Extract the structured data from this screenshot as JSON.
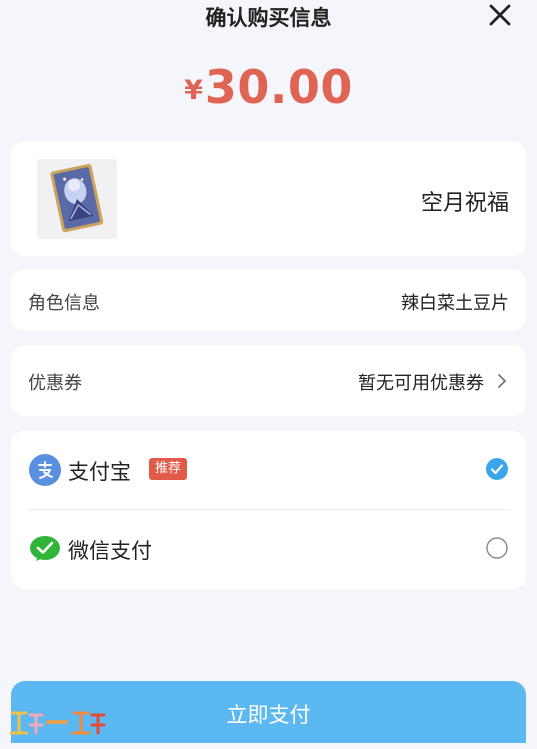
{
  "header": {
    "title": "确认购买信息",
    "close_icon": "close-icon"
  },
  "price": {
    "currency": "¥",
    "amount": "30.00",
    "color": "#e06454"
  },
  "product": {
    "name": "空月祝福",
    "thumbnail_icon": "card-artwork-thumbnail"
  },
  "role": {
    "label": "角色信息",
    "value": "辣白菜土豆片"
  },
  "coupon": {
    "label": "优惠券",
    "value": "暂无可用优惠券",
    "chevron_icon": "chevron-right-icon"
  },
  "payment": {
    "options": [
      {
        "label": "支付宝",
        "badge": "推荐",
        "icon": "alipay-icon",
        "selected": true
      },
      {
        "label": "微信支付",
        "icon": "wechat-pay-icon",
        "selected": false
      }
    ]
  },
  "button": {
    "label": "立即支付",
    "color": "#5cb8f0"
  },
  "watermark": {
    "icon": "site-watermark-logo"
  }
}
